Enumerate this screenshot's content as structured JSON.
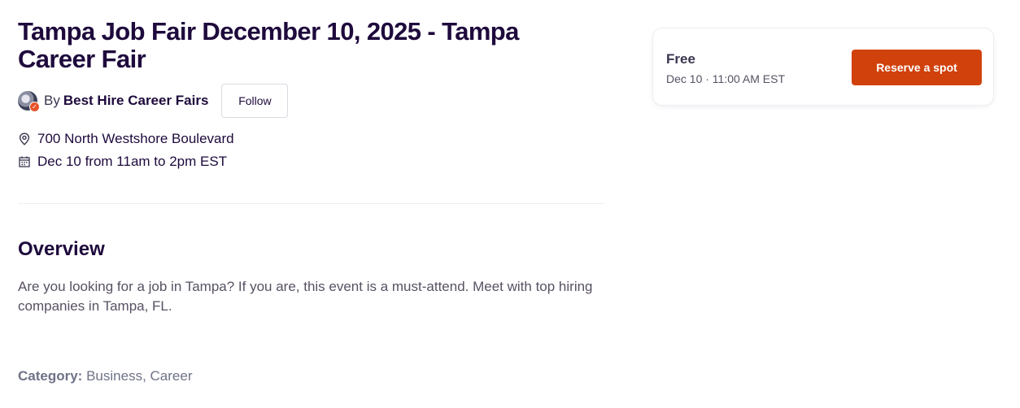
{
  "event": {
    "title": "Tampa Job Fair December 10, 2025 - Tampa Career Fair",
    "organizer": {
      "by_label": "By",
      "name": "Best Hire Career Fairs",
      "follow_label": "Follow",
      "avatar_icon": "organizer-avatar",
      "badge_icon": "verified-badge-icon"
    },
    "location": {
      "icon": "map-pin-icon",
      "text": "700 North Westshore Boulevard"
    },
    "date": {
      "icon": "calendar-icon",
      "text": "Dec 10 from 11am to 2pm EST"
    }
  },
  "overview": {
    "heading": "Overview",
    "text": "Are you looking for a job in Tampa? If you are, this event is a must-attend. Meet with top hiring companies in Tampa, FL."
  },
  "category": {
    "label": "Category:",
    "value": "Business, Career"
  },
  "ticket": {
    "price": "Free",
    "date": "Dec 10 · 11:00 AM EST",
    "reserve_label": "Reserve a spot"
  },
  "colors": {
    "title": "#1e0a3c",
    "accent_button": "#d1410c",
    "body_text": "#585163",
    "muted_text": "#6f7287",
    "badge": "#e7542a"
  }
}
